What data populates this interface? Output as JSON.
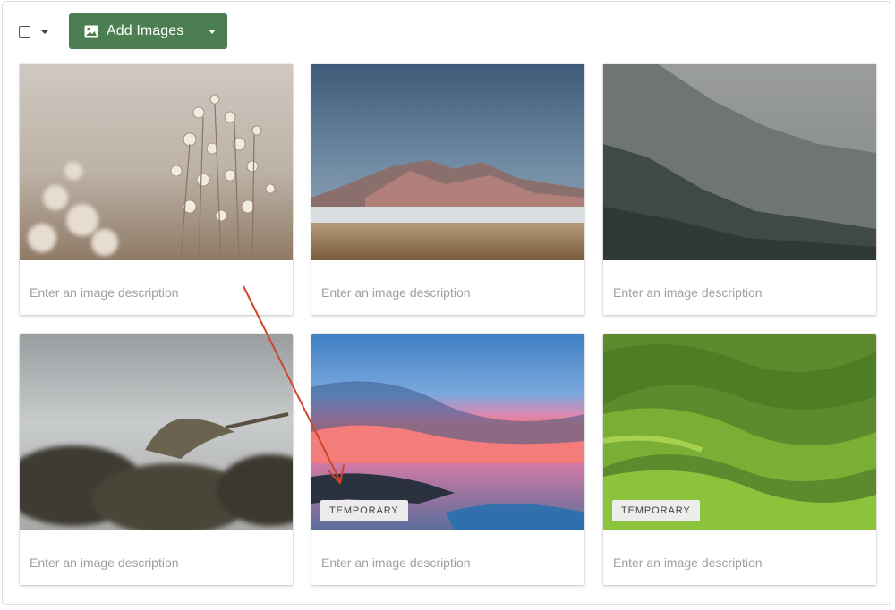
{
  "toolbar": {
    "select_all_checked": false,
    "add_images_label": "Add Images",
    "button_color": "#4b7f52"
  },
  "gallery": {
    "description_placeholder": "Enter an image description",
    "cards": [
      {
        "subject": "dried wildflowers",
        "badge": ""
      },
      {
        "subject": "desert mountains",
        "badge": ""
      },
      {
        "subject": "misty forest hills",
        "badge": ""
      },
      {
        "subject": "bird on rocks",
        "badge": ""
      },
      {
        "subject": "sunset over sea",
        "badge": "TEMPORARY"
      },
      {
        "subject": "green rolling hills",
        "badge": "TEMPORARY"
      }
    ]
  },
  "annotation": {
    "color": "#d0452a"
  }
}
